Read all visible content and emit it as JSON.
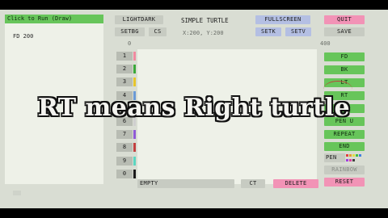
{
  "code_panel": {
    "run_label": "Click to Run (Draw)",
    "lines": [
      "FD 200"
    ]
  },
  "top": {
    "lightdark": "LIGHTDARK",
    "setbg": "SETBG",
    "cs": "CS",
    "title": "SIMPLE TURTLE",
    "coords": "X:200, Y:200",
    "fullscreen": "FULLSCREEN",
    "setk": "SETK",
    "setv": "SETV",
    "quit": "QUIT",
    "save": "SAVE"
  },
  "axis": {
    "x_start": "0",
    "x_end": "400"
  },
  "slots": [
    "1",
    "2",
    "3",
    "4",
    "5",
    "6",
    "7",
    "8",
    "9",
    "0"
  ],
  "slot_colors": [
    "#f08aa0",
    "#3aa83a",
    "#e7c52c",
    "#6a9ad6",
    "#30c7c7",
    "#cfcfcf",
    "#8f5ad6",
    "#c24040",
    "#5bd6c0",
    "#1a1a1a"
  ],
  "commands": {
    "fd": "FD",
    "bk": "BK",
    "lt": "LT",
    "rt": "RT",
    "pen_up": "PEN U",
    "repeat": "REPEAT",
    "end": "END",
    "pen": "PEN",
    "rainbow": "RAINBOW",
    "reset": "RESET"
  },
  "palette_colors": [
    "#e04040",
    "#e0a030",
    "#e0e040",
    "#40c040",
    "#4080e0",
    "#a040e0",
    "#e040a0",
    "#404040"
  ],
  "bottom": {
    "empty": "EMPTY",
    "ct": "CT",
    "delete": "DELETE"
  },
  "overlay_caption": "RT means Right turtle"
}
